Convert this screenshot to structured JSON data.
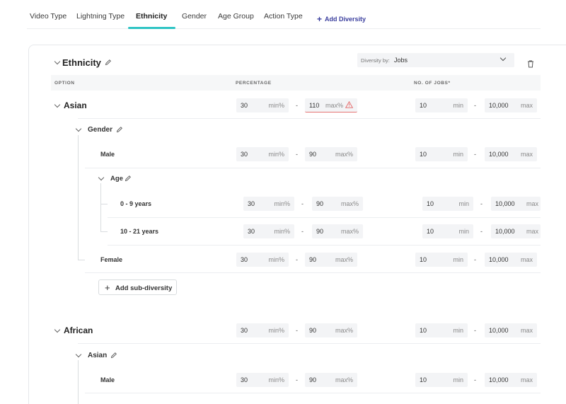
{
  "tabs": {
    "items": [
      {
        "label": "Video Type"
      },
      {
        "label": "Lightning Type"
      },
      {
        "label": "Ethnicity"
      },
      {
        "label": "Gender"
      },
      {
        "label": "Age Group"
      },
      {
        "label": "Action Type"
      }
    ],
    "add_diversity": "Add Diversity",
    "add_icon": "+",
    "active_index": 2
  },
  "section": {
    "title": "Ethnicity",
    "diversity_by_label": "Diversity by:",
    "diversity_by_value": "Jobs"
  },
  "table_headers": {
    "option": "OPTION",
    "percentage": "PERCENTAGE",
    "jobs": "NO. OF JOBS*"
  },
  "units": {
    "min_pct": "min%",
    "max_pct": "max%",
    "min": "min",
    "max": "max"
  },
  "dash": "-",
  "groups": {
    "asian": {
      "label": "Asian",
      "pct_min": "30",
      "pct_max": "110",
      "jobs_min": "10",
      "jobs_max": "10,000",
      "pct_max_warning": true,
      "gender": {
        "label": "Gender",
        "male": {
          "label": "Male",
          "pct_min": "30",
          "pct_max": "90",
          "jobs_min": "10",
          "jobs_max": "10,000"
        },
        "age": {
          "label": "Age",
          "rows": [
            {
              "label": "0 - 9 years",
              "pct_min": "30",
              "pct_max": "90",
              "jobs_min": "10",
              "jobs_max": "10,000"
            },
            {
              "label": "10 - 21 years",
              "pct_min": "30",
              "pct_max": "90",
              "jobs_min": "10",
              "jobs_max": "10,000"
            }
          ]
        },
        "female": {
          "label": "Female",
          "pct_min": "30",
          "pct_max": "90",
          "jobs_min": "10",
          "jobs_max": "10,000"
        }
      },
      "add_sub_label": "Add sub-diversity",
      "add_sub_icon": "+"
    },
    "african": {
      "label": "African",
      "pct_min": "30",
      "pct_max": "90",
      "jobs_min": "10",
      "jobs_max": "10,000",
      "sub": {
        "label": "Asian",
        "male": {
          "label": "Male",
          "pct_min": "30",
          "pct_max": "90",
          "jobs_min": "10",
          "jobs_max": "10,000"
        }
      }
    }
  },
  "icons": {
    "pencil": "pencil-icon",
    "chevron": "chevron-down-icon",
    "trash": "trash-icon",
    "warning": "warning-icon",
    "plus": "plus-icon"
  },
  "colors": {
    "accent": "#2ec4c4",
    "link": "#3b3f9e",
    "warning": "#e57373",
    "input_bg": "#f3f4f6"
  }
}
